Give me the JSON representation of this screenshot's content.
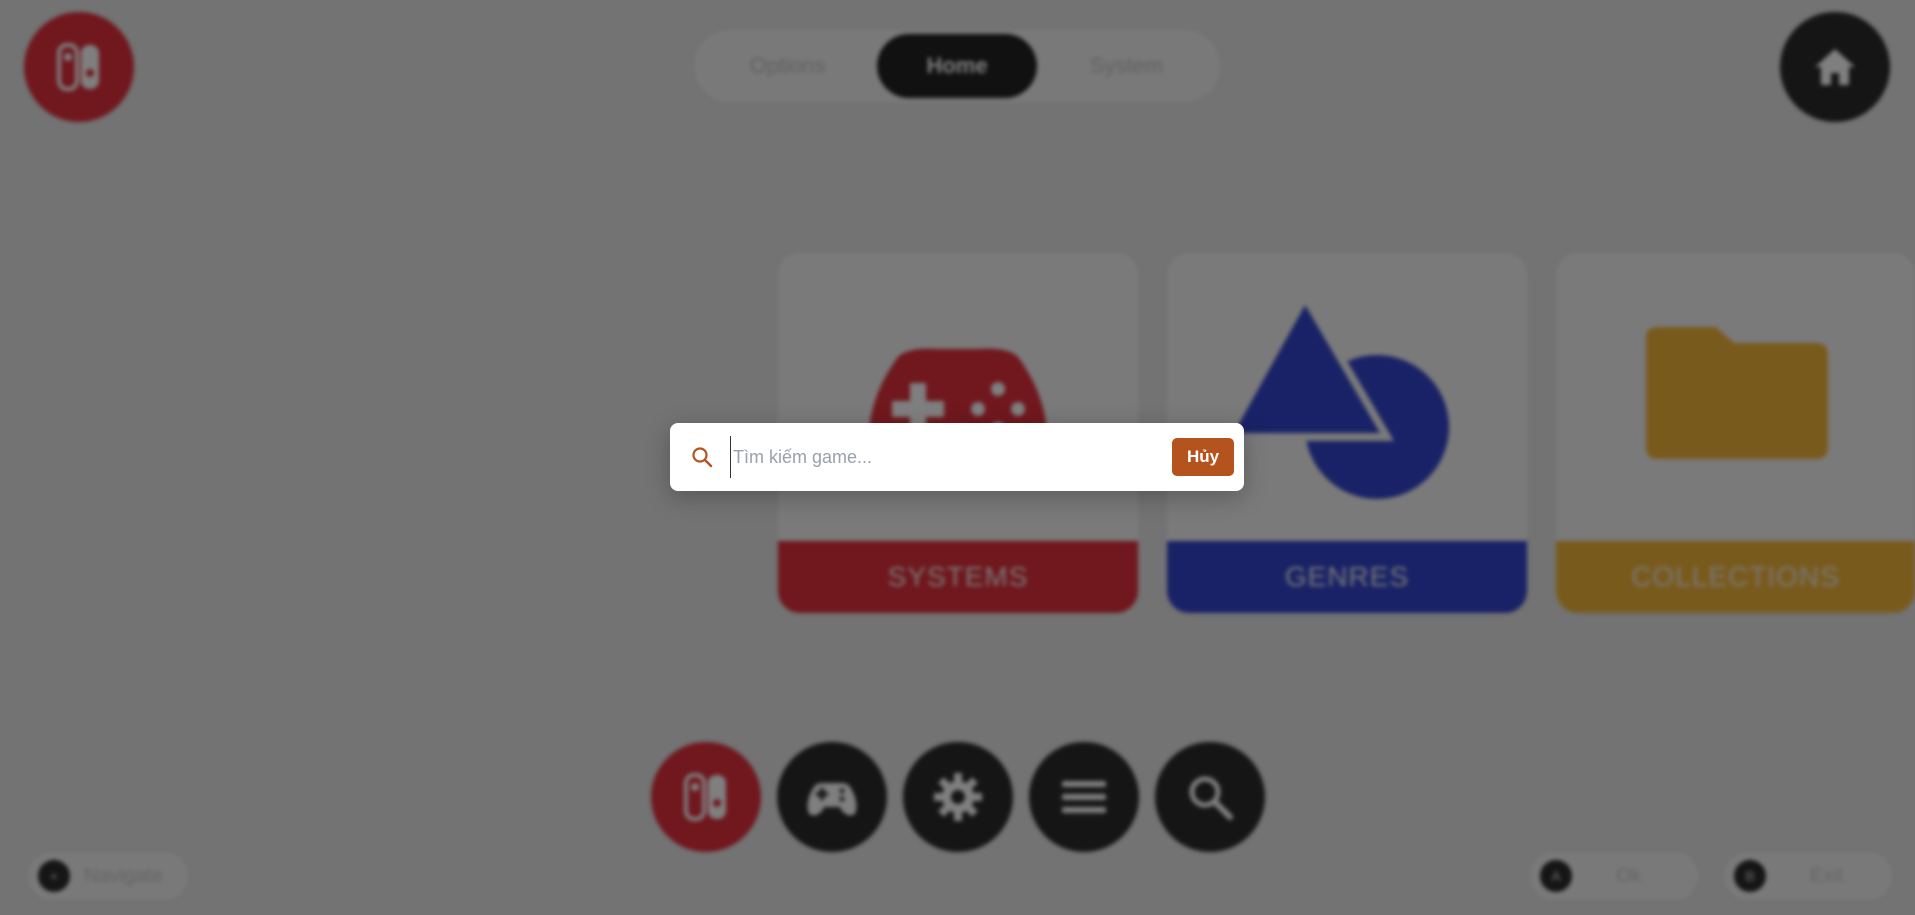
{
  "header": {
    "tabs": [
      {
        "label": "Options",
        "active": false
      },
      {
        "label": "Home",
        "active": true
      },
      {
        "label": "System",
        "active": false
      }
    ]
  },
  "cards": [
    {
      "label": "SYSTEMS",
      "color": "#e0303c"
    },
    {
      "label": "GENRES",
      "color": "#3345cc"
    },
    {
      "label": "COLLECTIONS",
      "color": "#f3b53a"
    }
  ],
  "dock": {
    "icons": [
      "switch-icon",
      "gamepad-icon",
      "gear-icon",
      "menu-icon",
      "search-icon"
    ]
  },
  "hints": {
    "navigate": {
      "key": "+",
      "label": "Navigate"
    },
    "ok": {
      "key": "A",
      "label": "Ok"
    },
    "exit": {
      "key": "B",
      "label": "Exit"
    }
  },
  "search_dialog": {
    "placeholder": "Tìm kiếm game...",
    "value": "",
    "cancel_label": "Hủy",
    "accent": "#b5531f"
  }
}
